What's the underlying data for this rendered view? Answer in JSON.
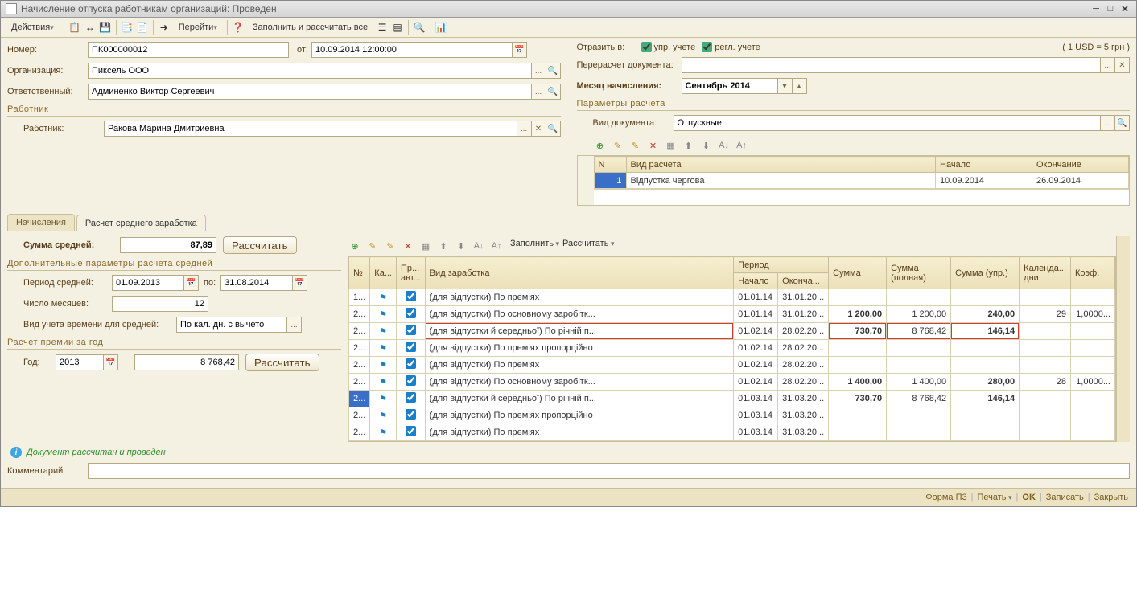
{
  "window": {
    "title": "Начисление отпуска работникам организаций: Проведен"
  },
  "toolbar": {
    "actions": "Действия",
    "go": "Перейти",
    "fill_calc": "Заполнить и рассчитать все"
  },
  "header": {
    "labels": {
      "number": "Номер:",
      "from": "от:",
      "org": "Организация:",
      "resp": "Ответственный:",
      "reflect": "Отразить в:",
      "mgmt": "упр. учете",
      "reg": "регл. учете",
      "recalc": "Перерасчет документа:",
      "month": "Месяц начисления:",
      "rate": "( 1 USD = 5 грн )"
    },
    "number": "ПК000000012",
    "date": "10.09.2014 12:00:00",
    "org": "Пиксель ООО",
    "resp": "Админенко Виктор Сергеевич",
    "month": "Сентябрь 2014"
  },
  "worker_section": {
    "title": "Работник",
    "label": "Работник:",
    "value": "Ракова Марина Дмитриевна"
  },
  "calc_section": {
    "title": "Параметры расчета",
    "doc_type_label": "Вид документа:",
    "doc_type": "Отпускные",
    "cols": {
      "n": "N",
      "type": "Вид расчета",
      "start": "Начало",
      "end": "Окончание"
    },
    "rows": [
      {
        "n": "1",
        "type": "Відпустка чергова",
        "start": "10.09.2014",
        "end": "26.09.2014"
      }
    ]
  },
  "tabs": {
    "t1": "Начисления",
    "t2": "Расчет среднего заработка"
  },
  "avg": {
    "sum_label": "Сумма средней:",
    "sum": "87,89",
    "calc_btn": "Рассчитать",
    "extra_title": "Дополнительные параметры расчета средней",
    "period_label": "Период средней:",
    "period_from": "01.09.2013",
    "to_label": "по:",
    "period_to": "31.08.2014",
    "months_label": "Число месяцев:",
    "months": "12",
    "time_label": "Вид учета времени для средней:",
    "time_val": "По кал. дн. с вычето",
    "bonus_title": "Расчет премии за год",
    "year_label": "Год:",
    "year": "2013",
    "bonus_val": "8 768,42",
    "bonus_btn": "Рассчитать"
  },
  "grid": {
    "toolbar": {
      "fill": "Заполнить",
      "calc": "Рассчитать"
    },
    "cols": {
      "n": "№",
      "ka": "Ка...",
      "pr": "Пр... авт...",
      "earn": "Вид заработка",
      "period": "Период",
      "pstart": "Начало",
      "pend": "Оконча...",
      "sum": "Сумма",
      "sumfull": "Сумма (полная)",
      "sumupr": "Сумма (упр.)",
      "days": "Календа... дни",
      "coef": "Коэф."
    },
    "rows": [
      {
        "n": "1...",
        "earn": "(для відпустки) По преміях",
        "ps": "01.01.14",
        "pe": "31.01.20...",
        "sum": "",
        "sf": "",
        "su": "",
        "d": "",
        "c": ""
      },
      {
        "n": "2...",
        "earn": "(для відпустки) По основному заробітк...",
        "ps": "01.01.14",
        "pe": "31.01.20...",
        "sum": "1 200,00",
        "sf": "1 200,00",
        "su": "240,00",
        "d": "29",
        "c": "1,0000..."
      },
      {
        "n": "2...",
        "earn": "(для відпустки й середньої) По річній п...",
        "ps": "01.02.14",
        "pe": "28.02.20...",
        "sum": "730,70",
        "sf": "8 768,42",
        "su": "146,14",
        "d": "",
        "c": "",
        "hl": true
      },
      {
        "n": "2...",
        "earn": "(для відпустки) По преміях пропорційно",
        "ps": "01.02.14",
        "pe": "28.02.20...",
        "sum": "",
        "sf": "",
        "su": "",
        "d": "",
        "c": ""
      },
      {
        "n": "2...",
        "earn": "(для відпустки) По преміях",
        "ps": "01.02.14",
        "pe": "28.02.20...",
        "sum": "",
        "sf": "",
        "su": "",
        "d": "",
        "c": ""
      },
      {
        "n": "2...",
        "earn": "(для відпустки) По основному заробітк...",
        "ps": "01.02.14",
        "pe": "28.02.20...",
        "sum": "1 400,00",
        "sf": "1 400,00",
        "su": "280,00",
        "d": "28",
        "c": "1,0000..."
      },
      {
        "n": "2...",
        "earn": "(для відпустки й середньої) По річній п...",
        "ps": "01.03.14",
        "pe": "31.03.20...",
        "sum": "730,70",
        "sf": "8 768,42",
        "su": "146,14",
        "d": "",
        "c": "",
        "sel": true
      },
      {
        "n": "2...",
        "earn": "(для відпустки) По преміях пропорційно",
        "ps": "01.03.14",
        "pe": "31.03.20...",
        "sum": "",
        "sf": "",
        "su": "",
        "d": "",
        "c": ""
      },
      {
        "n": "2...",
        "earn": "(для відпустки) По преміях",
        "ps": "01.03.14",
        "pe": "31.03.20...",
        "sum": "",
        "sf": "",
        "su": "",
        "d": "",
        "c": ""
      }
    ]
  },
  "status": "Документ рассчитан и проведен",
  "comment_label": "Комментарий:",
  "footer": {
    "form": "Форма П3",
    "print": "Печать",
    "ok": "OK",
    "save": "Записать",
    "close": "Закрыть"
  }
}
